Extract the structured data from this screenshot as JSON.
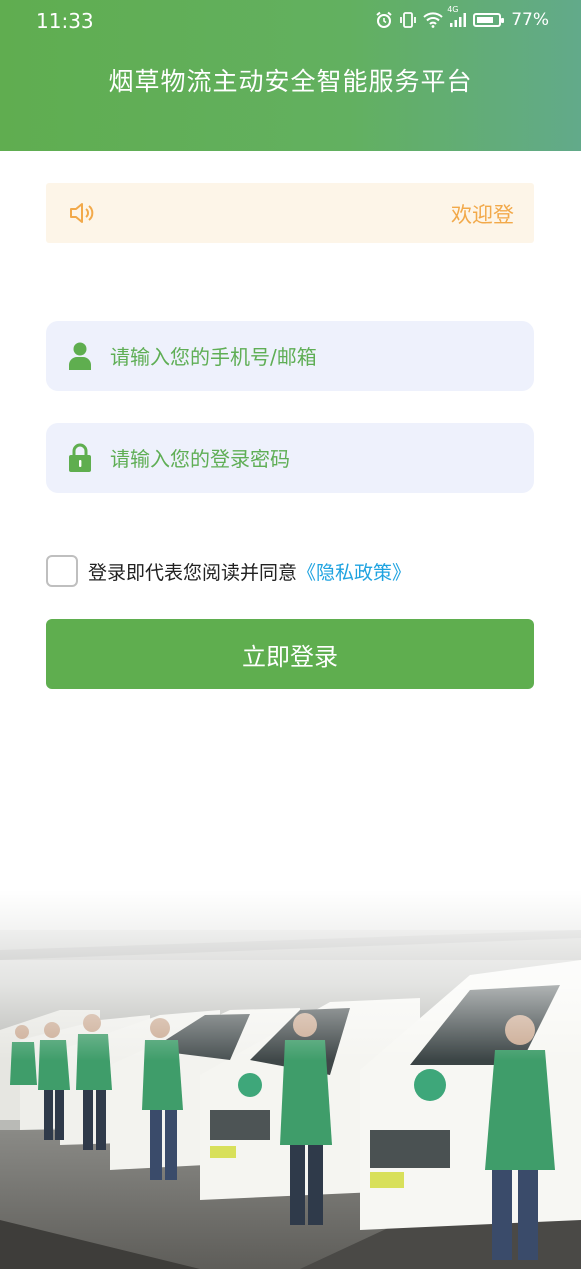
{
  "status_bar": {
    "time": "11:33",
    "network": "4G",
    "battery_percent": "77%",
    "battery_level": 0.77,
    "icons": [
      "alarm-icon",
      "vibrate-icon",
      "wifi-icon",
      "signal-icon",
      "battery-icon"
    ]
  },
  "header": {
    "title": "烟草物流主动安全智能服务平台"
  },
  "notice": {
    "icon": "speaker-icon",
    "text": "欢迎登"
  },
  "login_form": {
    "username_placeholder": "请输入您的手机号/邮箱",
    "username_value": "",
    "password_placeholder": "请输入您的登录密码",
    "password_value": "",
    "agreement_checked": false,
    "agreement_text": "登录即代表您阅读并同意",
    "policy_link": "《隐私政策》",
    "submit_label": "立即登录"
  },
  "colors": {
    "brand_green": "#5fae4f",
    "header_gradient_start": "#60ad50",
    "header_gradient_end": "#62aa8a",
    "notice_bg": "#fdf5e8",
    "notice_text": "#f2a94a",
    "input_bg": "#eef1fc",
    "link": "#1fa3e0"
  }
}
